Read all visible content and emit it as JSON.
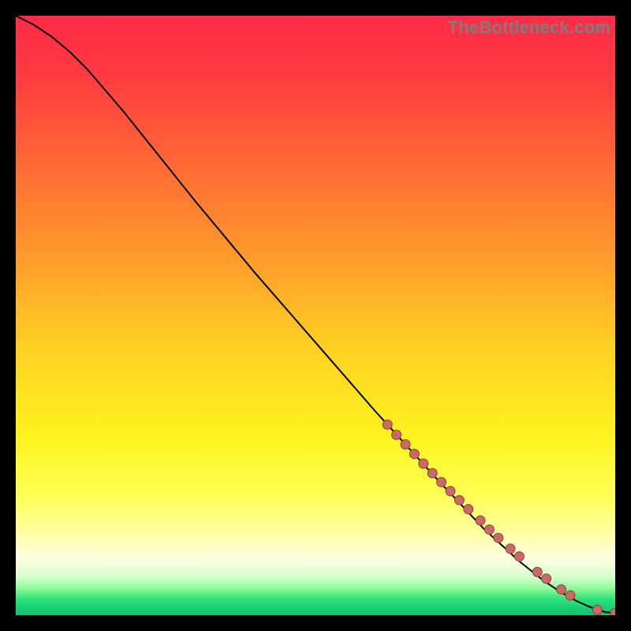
{
  "watermark": "TheBottleneck.com",
  "colors": {
    "background": "#000000",
    "curve": "#000000",
    "marker_fill": "#c96a67",
    "marker_stroke": "#8f3f3c",
    "gradient_stops": [
      {
        "offset": 0.0,
        "color": "#ff2b47"
      },
      {
        "offset": 0.1,
        "color": "#ff3b40"
      },
      {
        "offset": 0.25,
        "color": "#ff6a35"
      },
      {
        "offset": 0.4,
        "color": "#ff9a2c"
      },
      {
        "offset": 0.55,
        "color": "#ffcf22"
      },
      {
        "offset": 0.7,
        "color": "#fff31e"
      },
      {
        "offset": 0.8,
        "color": "#ffff55"
      },
      {
        "offset": 0.86,
        "color": "#ffffa0"
      },
      {
        "offset": 0.905,
        "color": "#fdffe0"
      },
      {
        "offset": 0.935,
        "color": "#d8ffce"
      },
      {
        "offset": 0.955,
        "color": "#8ffb9a"
      },
      {
        "offset": 0.975,
        "color": "#28e07a"
      },
      {
        "offset": 1.0,
        "color": "#10c070"
      }
    ]
  },
  "chart_data": {
    "type": "line",
    "title": "",
    "xlabel": "",
    "ylabel": "",
    "xlim": [
      0,
      100
    ],
    "ylim": [
      0,
      100
    ],
    "grid": false,
    "legend": false,
    "series": [
      {
        "name": "curve",
        "x": [
          0,
          3,
          6,
          9,
          12,
          15,
          18,
          22,
          30,
          40,
          50,
          60,
          70,
          78,
          84,
          88,
          91,
          93.5,
          95.5,
          97,
          98.5,
          100
        ],
        "y": [
          100,
          98.5,
          96.5,
          94,
          91,
          87.5,
          84,
          79,
          69,
          57,
          45.5,
          34,
          23,
          14.5,
          9,
          5.8,
          3.8,
          2.4,
          1.5,
          0.9,
          0.5,
          0.4
        ]
      }
    ],
    "markers": {
      "name": "highlighted-points",
      "x": [
        62,
        63.5,
        65,
        66.5,
        68,
        69.5,
        71,
        72.5,
        74,
        75.5,
        77.5,
        79,
        80.5,
        82.5,
        84,
        87,
        88.5,
        91,
        92.5,
        97,
        100
      ],
      "y": [
        31.8,
        30.1,
        28.5,
        26.9,
        25.3,
        23.7,
        22.2,
        20.7,
        19.2,
        17.7,
        15.8,
        14.3,
        12.9,
        11.1,
        9.8,
        7.2,
        6.1,
        4.3,
        3.3,
        0.9,
        0.4
      ],
      "r": 6
    }
  }
}
